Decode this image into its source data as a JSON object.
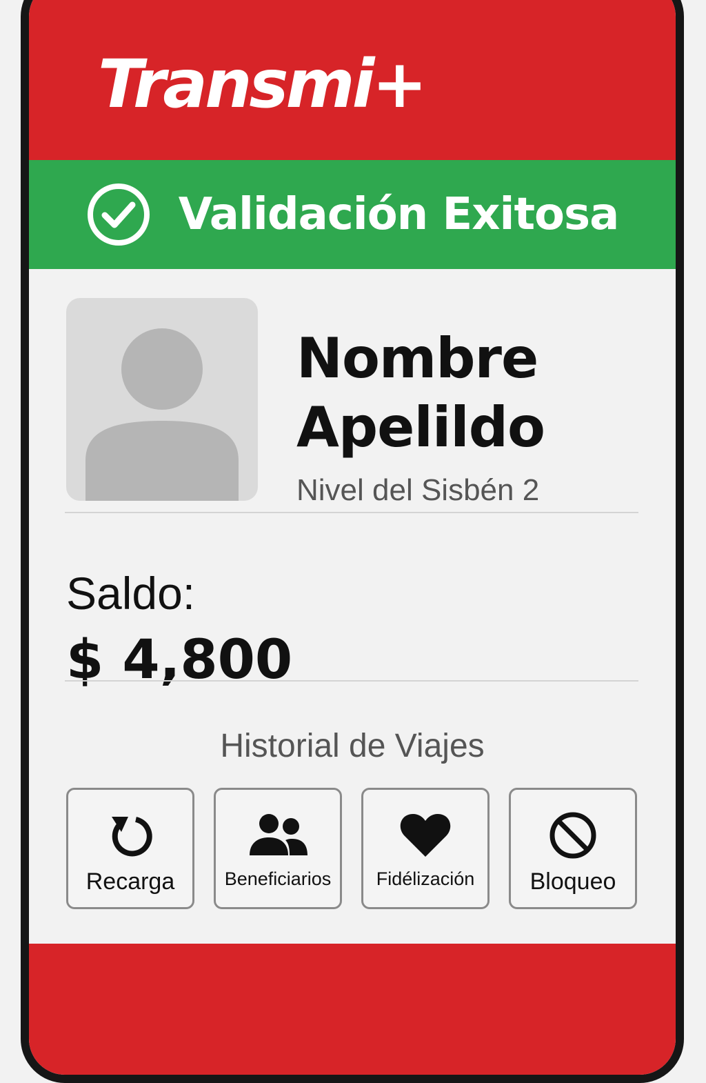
{
  "header": {
    "brand": "Transmi+"
  },
  "status_banner": {
    "text": "Validación Exitosa",
    "icon": "check-circle-icon",
    "color": "#2fa84f"
  },
  "profile": {
    "name_line1": "Nombre",
    "name_line2": "Apelildo",
    "level": "Nivel del Sisbén 2",
    "avatar_icon": "user-avatar-placeholder"
  },
  "balance": {
    "label": "Saldo:",
    "value": "$ 4,800"
  },
  "history": {
    "label": "Historial de Viajes"
  },
  "actions": [
    {
      "label": "Recarga",
      "icon": "refresh-icon"
    },
    {
      "label": "Beneficiarios",
      "icon": "users-icon"
    },
    {
      "label": "Fidélización",
      "icon": "heart-icon"
    },
    {
      "label": "Bloqueo",
      "icon": "block-icon"
    }
  ],
  "colors": {
    "brand_red": "#d72428",
    "success_green": "#2fa84f",
    "background": "#f2f2f2"
  }
}
